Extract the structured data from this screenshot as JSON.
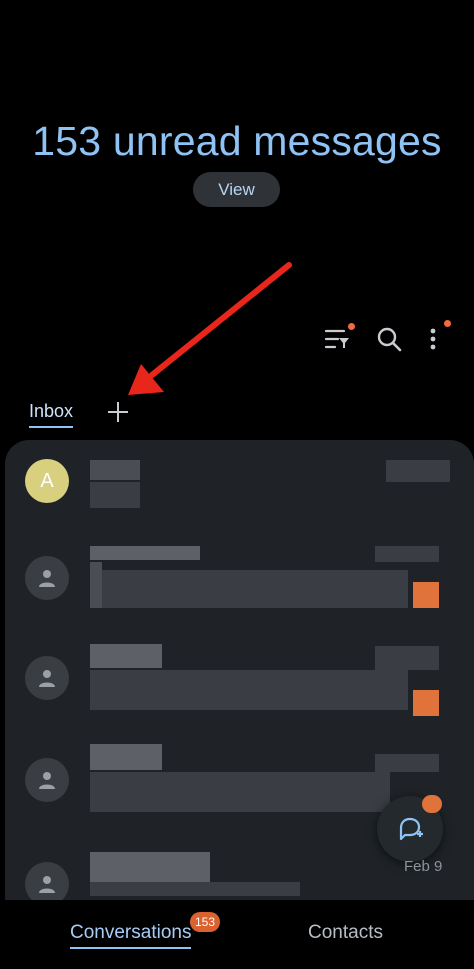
{
  "header": {
    "title": "153 unread messages",
    "view_label": "View"
  },
  "toolbar": {
    "icons": [
      "filter-icon",
      "search-icon",
      "more-options-icon"
    ]
  },
  "tabs": {
    "inbox_label": "Inbox",
    "add_icon": "plus-icon"
  },
  "conversations": {
    "first_avatar_letter": "A",
    "visible_date": "Feb 9"
  },
  "fab": {
    "icon": "new-message-icon"
  },
  "bottom_nav": {
    "conversations_label": "Conversations",
    "conversations_badge": "153",
    "contacts_label": "Contacts"
  },
  "colors": {
    "accent": "#8fc3f5",
    "badge": "#d9622f",
    "annotation_arrow": "#e8261c",
    "panel": "#1f2327"
  }
}
